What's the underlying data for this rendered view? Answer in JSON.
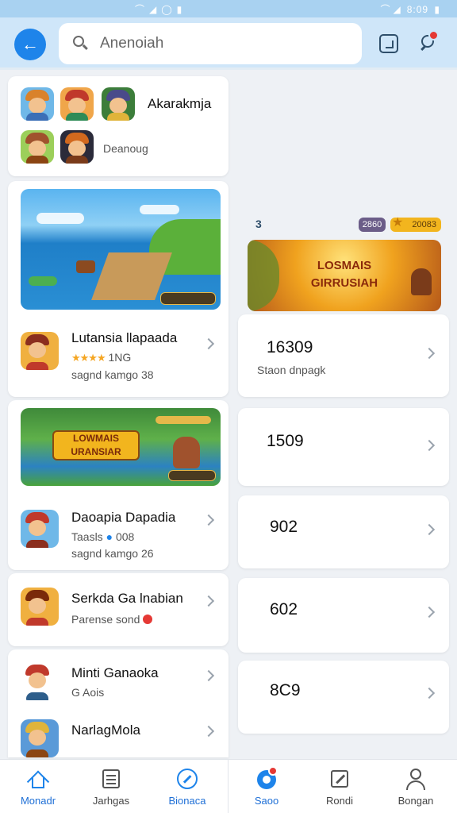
{
  "search": {
    "placeholder": "Anenoiah"
  },
  "status": {
    "time": "8:09"
  },
  "top_apps": {
    "label_1": "Akarakmja",
    "label_2": "Deanoug"
  },
  "left_list": [
    {
      "title": "Lutansia llapaada",
      "rating": "★★★★",
      "rating_text": "1NG",
      "subtitle": "sagnd kamgo 38"
    },
    {
      "title": "Daoapia Dapadia",
      "rating": "Taasls",
      "rating_text": "008",
      "subtitle": "sagnd kamgo 26"
    },
    {
      "title": "Serkda Ga lnabian",
      "subtitle": "Parense sond"
    },
    {
      "title": "Minti Ganaoka",
      "subtitle": "G Aois"
    },
    {
      "title": "NarlagMola"
    }
  ],
  "banner_text": {
    "right_banner": "LOSMAIS GIRRUSIAH",
    "left_banner_2": "LOWMAIS URANSIAR"
  },
  "right_badges": {
    "left": "3",
    "mid": "2860",
    "gold": "20083"
  },
  "right_list": [
    {
      "value": "16309",
      "subtitle": "Staon dnpagk"
    },
    {
      "value": "1509"
    },
    {
      "value": "902"
    },
    {
      "value": "602"
    },
    {
      "value": "8C9"
    }
  ],
  "bottom_nav": [
    {
      "label": "Monadr",
      "icon": "home-icon"
    },
    {
      "label": "Jarhgas",
      "icon": "list-icon"
    },
    {
      "label": "Bionaca",
      "icon": "compass-icon"
    },
    {
      "label": "Saoo",
      "icon": "chat-icon"
    },
    {
      "label": "Rondi",
      "icon": "pen-icon"
    },
    {
      "label": "Bongan",
      "icon": "profile-icon"
    }
  ],
  "colors": {
    "accent": "#1e84ea",
    "app_bar": "#cfe6f9",
    "badge": "#e53935"
  }
}
